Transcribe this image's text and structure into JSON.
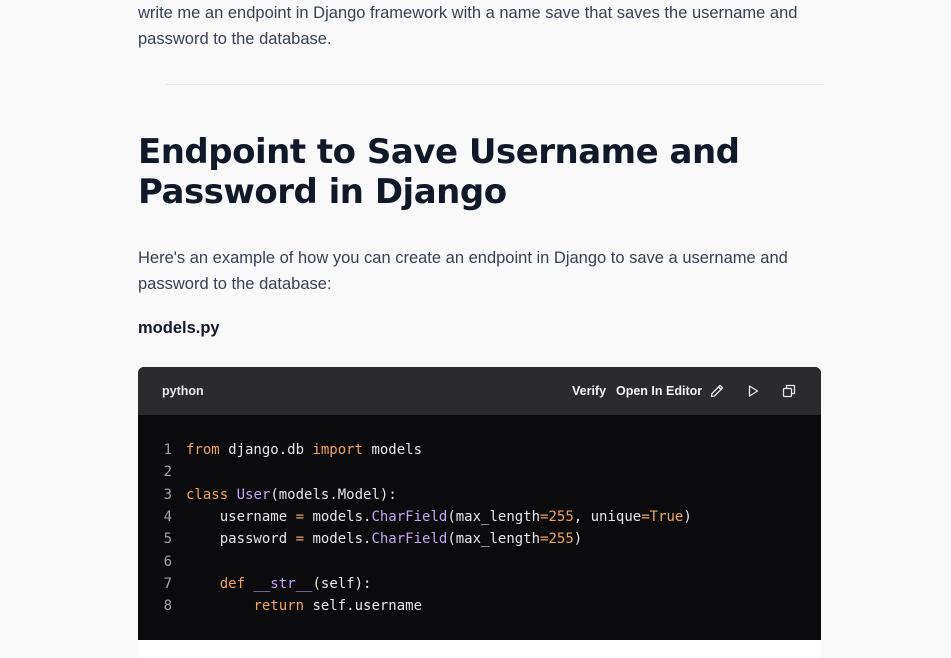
{
  "prompt": {
    "text": "write me an endpoint in Django framework with a name save that saves the username and password to the database."
  },
  "response": {
    "heading": "Endpoint to Save Username and Password in Django",
    "intro": "Here's an example of how you can create an endpoint in Django to save a username and password to the database:",
    "filename": "models.py"
  },
  "code_block": {
    "language": "python",
    "verify_label": "Verify",
    "open_editor_label": "Open In Editor",
    "icons": [
      "pencil-icon",
      "play-icon",
      "copy-icon"
    ],
    "lines": [
      {
        "n": "1",
        "code": "from django.db import models"
      },
      {
        "n": "2",
        "code": ""
      },
      {
        "n": "3",
        "code": "class User(models.Model):"
      },
      {
        "n": "4",
        "code": "    username = models.CharField(max_length=255, unique=True)"
      },
      {
        "n": "5",
        "code": "    password = models.CharField(max_length=255)"
      },
      {
        "n": "6",
        "code": ""
      },
      {
        "n": "7",
        "code": "    def __str__(self):"
      },
      {
        "n": "8",
        "code": "        return self.username"
      }
    ]
  },
  "colors": {
    "background": "#f9f9fa",
    "code_bg": "#0b0b0d",
    "code_header_bg": "#2b2b2d",
    "keyword": "#f0a35e",
    "class_name": "#c4a5f5",
    "heading": "#111827"
  }
}
